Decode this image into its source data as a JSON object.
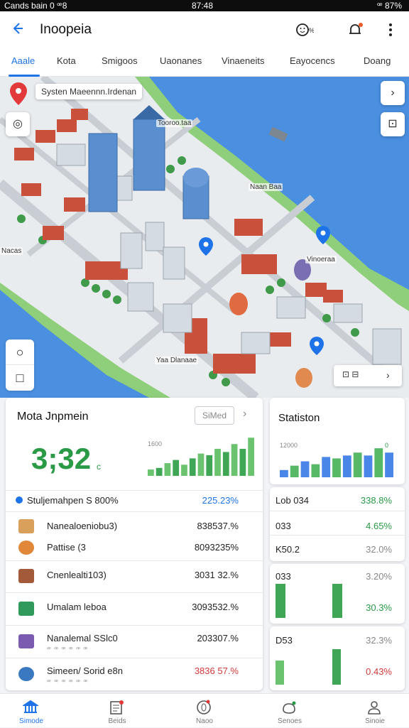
{
  "status": {
    "left": "Cands bain 0 ꟹ8",
    "center": "87:48",
    "right": "ꟹ 87%"
  },
  "appbar": {
    "title": "Inoopeia",
    "icon_left": "emoji-icon",
    "icon_right": "bell-icon"
  },
  "tabs": [
    "Aaale",
    "Kota",
    "Smigoos",
    "Uaonanes",
    "Vinaeneits",
    "Eayocencs",
    "Doang"
  ],
  "map": {
    "chip_label": "Systen  Maeennn.Irdenan",
    "labels": [
      "Tooroo.taa",
      "Naan Baa",
      "Nacas",
      "Vinoeraa",
      "Yaa Dlanaae"
    ],
    "controls": {
      "expand": "›",
      "recenter": "◎",
      "layers": "⊡",
      "circle": "○",
      "square": "□",
      "nav_next": "›"
    }
  },
  "left_card": {
    "title": "Mota Jnpmein",
    "button": "SiMed",
    "big_value": "3;32",
    "big_unit": "c",
    "chart_top_label": "1600",
    "header_row": {
      "label": "Stuljemahpen S 800%",
      "value": "225.23%"
    },
    "rows": [
      {
        "label": "Nanealoeniobu3)",
        "sub": "",
        "value": "838537.%",
        "color": "#2a9a47"
      },
      {
        "label": "Pattise (3",
        "sub": "",
        "value": "8093235%",
        "color": "#2a9a47"
      },
      {
        "label": "Cnenlealti103)",
        "sub": "",
        "value": "3031 32.%",
        "color": "#2a9a47"
      },
      {
        "label": "Umalam leboa",
        "sub": "",
        "value": "3093532.%",
        "color": "#2a9a47"
      },
      {
        "label": "Nanalemal SSlc0",
        "sub": "ꟹ ꟹ ꟹ ꟹ ꟹ ꟹ",
        "value": "203307.%",
        "color": "#222222"
      },
      {
        "label": "Simeen/ Sorid e8n",
        "sub": "ꟹ ꟹ ꟹ ꟹ ꟹ ꟹ",
        "value": "3836 57.%",
        "color": "#d23a3a"
      }
    ]
  },
  "right_card": {
    "title": "Statiston",
    "chart_top_label": "12000",
    "chart_right_label": "0",
    "rows_a": [
      {
        "label": "Lob 034",
        "value": "338.8%",
        "color": "#2a9a47"
      },
      {
        "label": "033",
        "value": "4.65%",
        "color": "#2a9a47"
      },
      {
        "label": "K50.2",
        "value": "32.0%",
        "color": "#888888"
      }
    ],
    "panel_b": {
      "label": "033",
      "top_value": "3.20%",
      "value": "30.3%",
      "color": "#2a9a47"
    },
    "panel_c": {
      "label": "D53",
      "top_value": "32.3%",
      "value": "0.43%",
      "color": "#d23a3a"
    }
  },
  "bottom_nav": [
    {
      "label": "Simode",
      "icon": "bank-icon",
      "active": true
    },
    {
      "label": "Beids",
      "icon": "document-icon",
      "active": false
    },
    {
      "label": "Naoo",
      "icon": "compass-icon",
      "active": false
    },
    {
      "label": "Senoes",
      "icon": "gift-icon",
      "active": false
    },
    {
      "label": "Sinoie",
      "icon": "person-icon",
      "active": false
    }
  ],
  "chart_data": [
    {
      "type": "bar",
      "categories": [
        "1",
        "2",
        "3",
        "4",
        "5",
        "6",
        "7",
        "8",
        "9",
        "10",
        "11",
        "12",
        "13"
      ],
      "values": [
        8,
        10,
        16,
        20,
        14,
        22,
        28,
        26,
        34,
        30,
        40,
        34,
        48
      ],
      "ylim": [
        0,
        50
      ],
      "colors": [
        "#6cc36f",
        "#3ea654"
      ]
    },
    {
      "type": "bar",
      "categories": [
        "1",
        "2",
        "3",
        "4",
        "5",
        "6",
        "7",
        "8",
        "9",
        "10",
        "11"
      ],
      "values": [
        10,
        16,
        22,
        18,
        28,
        26,
        30,
        34,
        30,
        40,
        34
      ],
      "ylim": [
        0,
        45
      ],
      "colors": [
        "#4a86e8",
        "#57b866"
      ]
    }
  ]
}
